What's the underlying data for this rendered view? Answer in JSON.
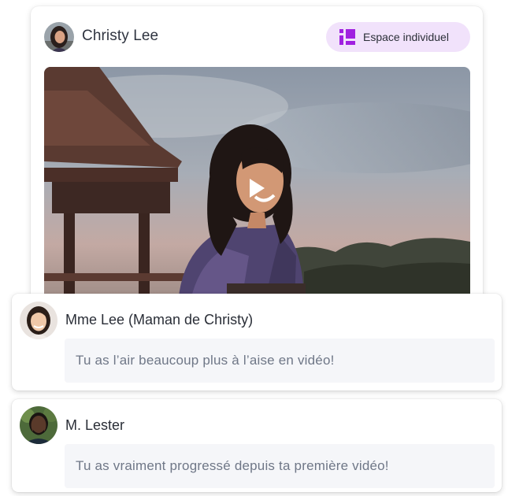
{
  "post": {
    "author": "Christy Lee",
    "badge_label": "Espace individuel",
    "badge_icon": "space-layout-icon",
    "media_type": "video",
    "accent_color": "#a020e0",
    "badge_bg": "#f1e2fb"
  },
  "comments": [
    {
      "author": "Mme Lee (Maman de Christy)",
      "text": "Tu as l’air beaucoup plus à l’aise en vidéo!"
    },
    {
      "author": "M. Lester",
      "text": "Tu as vraiment progressé depuis ta première vidéo!"
    }
  ]
}
